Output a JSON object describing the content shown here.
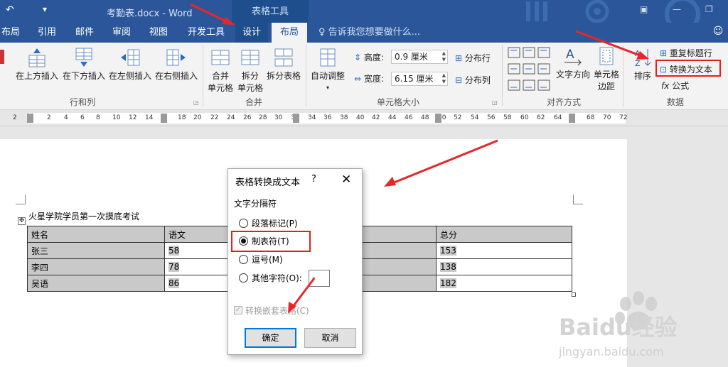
{
  "titlebar": {
    "qa_icon": "undo-icon",
    "customize_icon": "dropdown-arrow-icon",
    "doc_title": "考勤表.docx - Word",
    "context_label": "表格工具",
    "ribbon_display_icon": "ribbon-display-icon",
    "minimize_icon": "minimize-icon",
    "restore_icon": "restore-icon"
  },
  "tabs": [
    {
      "label": "布局"
    },
    {
      "label": "引用"
    },
    {
      "label": "邮件"
    },
    {
      "label": "审阅"
    },
    {
      "label": "视图"
    },
    {
      "label": "开发工具"
    },
    {
      "label": "设计"
    },
    {
      "label": "布局"
    }
  ],
  "tell_me": "告诉我您想要做什么...",
  "ribbon": {
    "rows_cols": {
      "label": "行和列",
      "insert_above": "在上方插入",
      "insert_below": "在下方插入",
      "insert_left": "在左侧插入",
      "insert_right": "在右侧插入"
    },
    "merge": {
      "label": "合并",
      "merge_cells_1": "合并",
      "merge_cells_2": "单元格",
      "split_cells_1": "拆分",
      "split_cells_2": "单元格",
      "split_table": "拆分表格"
    },
    "cell_size": {
      "label": "单元格大小",
      "autofit": "自动调整",
      "height_label": "高度:",
      "height_value": "0.9 厘米",
      "width_label": "宽度:",
      "width_value": "6.15 厘米",
      "distribute_rows": "分布行",
      "distribute_cols": "分布列"
    },
    "alignment": {
      "label": "对齐方式",
      "text_direction": "文字方向",
      "cell_margins_1": "单元格",
      "cell_margins_2": "边距"
    },
    "data": {
      "label": "数据",
      "sort": "排序",
      "repeat_header": "重复标题行",
      "convert_to_text": "转换为文本",
      "formula": "公式"
    }
  },
  "ruler_ticks": [
    "2",
    "2",
    "4",
    "6",
    "8",
    "10",
    "12",
    "14",
    "18",
    "20",
    "22",
    "24",
    "26",
    "28",
    "30",
    "32",
    "34",
    "36",
    "38",
    "40",
    "42",
    "44",
    "46",
    "48",
    "50",
    "52",
    "54",
    "56",
    "58",
    "60",
    "62",
    "64",
    "68",
    "70",
    "72"
  ],
  "document": {
    "heading": "火星学院学员第一次摸底考试",
    "table": {
      "header": [
        "姓名",
        "语文",
        "",
        "总分"
      ],
      "rows": [
        [
          "张三",
          "58",
          "",
          "153"
        ],
        [
          "李四",
          "78",
          "",
          "138"
        ],
        [
          "吴语",
          "86",
          "",
          "182"
        ]
      ]
    }
  },
  "dialog": {
    "title": "表格转换成文本",
    "help": "?",
    "close": "✕",
    "section": "文字分隔符",
    "options": [
      "段落标记(P)",
      "制表符(T)",
      "逗号(M)",
      "其他字符(O):"
    ],
    "selected_index": 1,
    "other_char_value": "-",
    "nested_label": "转换嵌套表格(C)",
    "nested_checked": true,
    "ok": "确定",
    "cancel": "取消"
  },
  "watermark": {
    "brand": "Baidu经验",
    "url": "jingyan.baidu.com"
  },
  "colors": {
    "word_blue": "#2b579a",
    "context_blue": "#1f4e8c",
    "highlight_red": "#e02020",
    "arrow_red": "#e8262a"
  }
}
